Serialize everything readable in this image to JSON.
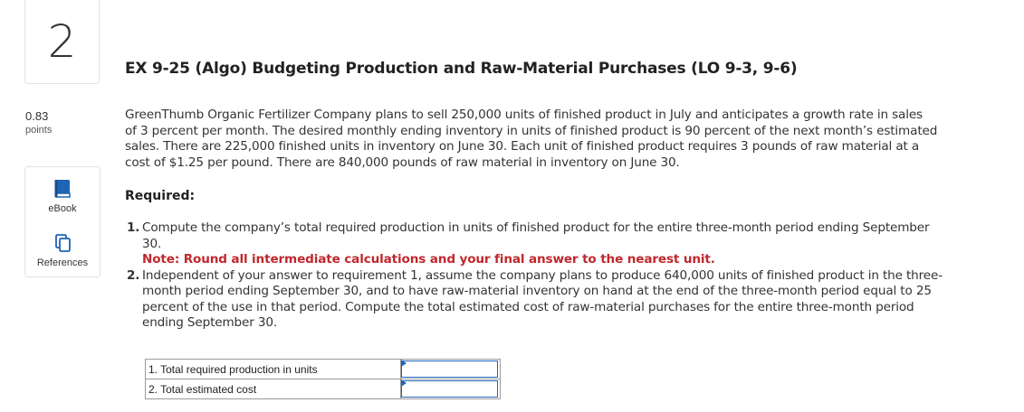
{
  "question": {
    "number": "2",
    "points_value": "0.83",
    "points_label": "points"
  },
  "sidebar": {
    "ebook_label": "eBook",
    "references_label": "References",
    "ebook_icon": "book-icon",
    "references_icon": "copy-icon",
    "icon_color": "#1f64b5"
  },
  "content": {
    "title": "EX 9-25 (Algo) Budgeting Production and Raw-Material Purchases (LO 9-3, 9-6)",
    "paragraph_lines": [
      "GreenThumb Organic Fertilizer Company plans to sell 250,000 units of finished product in July and anticipates a growth rate in sales",
      "of 3 percent per month. The desired monthly ending inventory in units of finished product is 90 percent of the next month’s estimated",
      "sales. There are 225,000 finished units in inventory on June 30. Each unit of finished product requires 3 pounds of raw material at a",
      "cost of $1.25 per pound. There are 840,000 pounds of raw material in inventory on June 30."
    ],
    "required_label": "Required:",
    "requirements": [
      {
        "number": "1.",
        "lines": [
          "Compute the company’s total required production in units of finished product for the entire three-month period ending September",
          "30."
        ],
        "note": "Note: Round all intermediate calculations and your final answer to the nearest unit."
      },
      {
        "number": "2.",
        "lines": [
          "Independent of your answer to requirement 1, assume the company plans to produce 640,000 units of finished product in the three-",
          "month period ending September 30, and to have raw-material inventory on hand at the end of the three-month period equal to 25",
          "percent of the use in that period. Compute the total estimated cost of raw-material purchases for the entire three-month period",
          "ending September 30."
        ],
        "note": ""
      }
    ]
  },
  "answer_table": {
    "rows": [
      {
        "label": "1. Total required production in units",
        "value": ""
      },
      {
        "label": "2. Total estimated cost",
        "value": ""
      }
    ]
  },
  "colors": {
    "note_red": "#c0282d",
    "input_border_blue": "#1f64b5"
  }
}
